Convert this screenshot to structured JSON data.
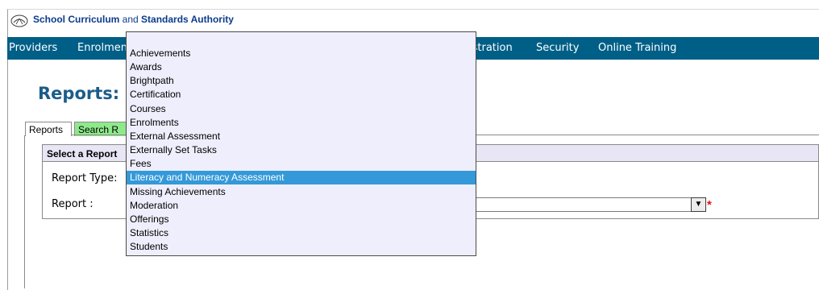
{
  "header": {
    "org_bold1": "School Curriculum",
    "org_and": " and ",
    "org_bold2": "Standards Authority"
  },
  "nav": {
    "items": [
      "Providers",
      "Enrolmen",
      "istration",
      "Security",
      "Online Training"
    ]
  },
  "page_title": "Reports: O",
  "tabs": [
    "Reports",
    "Search R"
  ],
  "section": {
    "title": "Select a Report",
    "report_type_label": "Report Type:",
    "report_label": "Report :",
    "required_marker": "*"
  },
  "dropdown": {
    "options": [
      "Achievements",
      "Awards",
      "Brightpath",
      "Certification",
      "Courses",
      "Enrolments",
      "External Assessment",
      "Externally Set Tasks",
      "Fees",
      "Literacy and Numeracy Assessment",
      "Missing Achievements",
      "Moderation",
      "Offerings",
      "Statistics",
      "Students"
    ],
    "selected": "Literacy and Numeracy Assessment"
  },
  "colors": {
    "nav_bg": "#005f87",
    "title": "#1a5c8a",
    "dropdown_bg": "#efeefc",
    "highlight": "#3399d8",
    "tab_search_bg": "#8fe98c",
    "required": "#e01414"
  }
}
